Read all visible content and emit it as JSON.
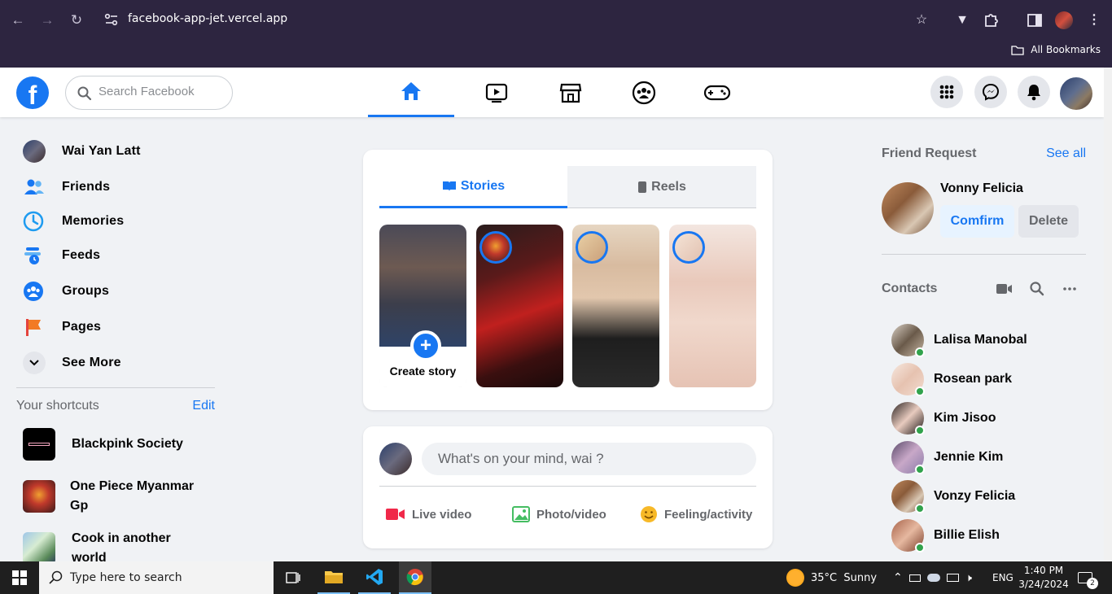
{
  "browser": {
    "url": "facebook-app-jet.vercel.app",
    "bookmarks_label": "All Bookmarks"
  },
  "header": {
    "logo_letter": "f",
    "search_placeholder": "Search Facebook"
  },
  "colors": {
    "brand": "#1877f2",
    "online": "#31a24c",
    "chrome_bg": "#2d2540"
  },
  "left_menu": [
    {
      "label": "Wai Yan Latt",
      "icon": "profile-avatar"
    },
    {
      "label": "Friends",
      "icon": "friends-icon"
    },
    {
      "label": "Memories",
      "icon": "clock-icon"
    },
    {
      "label": "Feeds",
      "icon": "feeds-icon"
    },
    {
      "label": "Groups",
      "icon": "groups-icon"
    },
    {
      "label": "Pages",
      "icon": "flag-icon"
    },
    {
      "label": "See More",
      "icon": "chevron-down-icon"
    }
  ],
  "shortcuts": {
    "title": "Your shortcuts",
    "edit_label": "Edit",
    "items": [
      {
        "label": "Blackpink Society"
      },
      {
        "label": "One Piece Myanmar Gp"
      },
      {
        "label": "Cook in another world"
      }
    ]
  },
  "stories": {
    "tab_stories": "Stories",
    "tab_reels": "Reels",
    "create_label": "Create story"
  },
  "composer": {
    "placeholder": "What's on your mind, wai ?",
    "actions": [
      {
        "label": "Live video",
        "icon": "live-video-icon",
        "color": "#f02849"
      },
      {
        "label": "Photo/video",
        "icon": "photo-icon",
        "color": "#45bd62"
      },
      {
        "label": "Feeling/activity",
        "icon": "smiley-icon",
        "color": "#f7b928"
      }
    ]
  },
  "friend_request": {
    "title": "Friend Request",
    "see_all": "See all",
    "name": "Vonny Felicia",
    "confirm": "Comfirm",
    "delete": "Delete"
  },
  "contacts": {
    "title": "Contacts",
    "items": [
      {
        "name": "Lalisa Manobal"
      },
      {
        "name": "Rosean park"
      },
      {
        "name": "Kim Jisoo"
      },
      {
        "name": "Jennie Kim"
      },
      {
        "name": "Vonzy Felicia"
      },
      {
        "name": "Billie Elish"
      }
    ]
  },
  "taskbar": {
    "search_placeholder": "Type here to search",
    "weather": "35°C  Sunny",
    "lang": "ENG",
    "time": "1:40 PM",
    "date": "3/24/2024",
    "notifications": "2"
  }
}
